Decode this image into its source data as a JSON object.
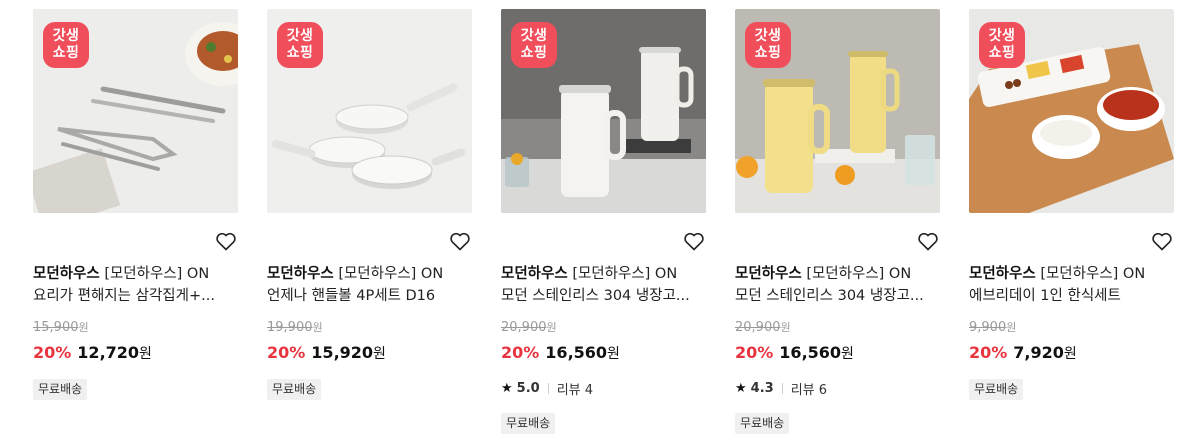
{
  "products": [
    {
      "badge": [
        "갓생",
        "쇼핑"
      ],
      "brand": "모던하우스",
      "title_line1": "[모던하우스] ON",
      "title_line2": "요리가 편해지는 삼각집게+...",
      "original_price": "15,900",
      "discount": "20%",
      "sale_price": "12,720",
      "rating": null,
      "review_label": null,
      "tag": "무료배송",
      "icons": {
        "heart": "heart-outline-icon"
      }
    },
    {
      "badge": [
        "갓생",
        "쇼핑"
      ],
      "brand": "모던하우스",
      "title_line1": "[모던하우스] ON",
      "title_line2": "언제나 핸들볼 4P세트 D16",
      "original_price": "19,900",
      "discount": "20%",
      "sale_price": "15,920",
      "rating": null,
      "review_label": null,
      "tag": "무료배송",
      "icons": {
        "heart": "heart-outline-icon"
      }
    },
    {
      "badge": [
        "갓생",
        "쇼핑"
      ],
      "brand": "모던하우스",
      "title_line1": "[모던하우스] ON",
      "title_line2": "모던 스테인리스 304 냉장고...",
      "original_price": "20,900",
      "discount": "20%",
      "sale_price": "16,560",
      "rating": "5.0",
      "review_label": "리뷰 4",
      "tag": "무료배송",
      "icons": {
        "heart": "heart-outline-icon"
      }
    },
    {
      "badge": [
        "갓생",
        "쇼핑"
      ],
      "brand": "모던하우스",
      "title_line1": "[모던하우스] ON",
      "title_line2": "모던 스테인리스 304 냉장고...",
      "original_price": "20,900",
      "discount": "20%",
      "sale_price": "16,560",
      "rating": "4.3",
      "review_label": "리뷰 6",
      "tag": "무료배송",
      "icons": {
        "heart": "heart-outline-icon"
      }
    },
    {
      "badge": [
        "갓생",
        "쇼핑"
      ],
      "brand": "모던하우스",
      "title_line1": "[모던하우스] ON",
      "title_line2": "에브리데이 1인 한식세트",
      "original_price": "9,900",
      "discount": "20%",
      "sale_price": "7,920",
      "rating": null,
      "review_label": null,
      "tag": "무료배송",
      "icons": {
        "heart": "heart-outline-icon"
      }
    }
  ],
  "currency_unit": "원",
  "colors": {
    "badge": "#f04e5a",
    "discount": "#e8343f",
    "strike": "#9a9a9a",
    "tag_bg": "#f0f0f0"
  }
}
